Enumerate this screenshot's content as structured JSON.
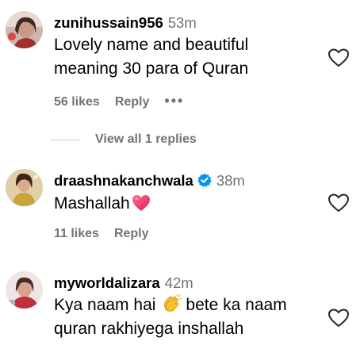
{
  "comments": [
    {
      "username": "zunihussain956",
      "time": "53m",
      "lines": [
        "Lovely name and beautiful",
        "meaning 30 para of Quran"
      ],
      "likes": "56 likes",
      "reply": "Reply",
      "more": "•••",
      "view_replies": "View all 1 replies"
    },
    {
      "username": "draashnakanchwala",
      "time": "38m",
      "verified": true,
      "text": "Mashallah",
      "emoji": "heart-emoji",
      "likes": "11 likes",
      "reply": "Reply"
    },
    {
      "username": "myworldalizara",
      "time": "42m",
      "line1_a": "Kya naam hai",
      "emoji": "clapping-hands-emoji",
      "line1_b": "bete ka naam",
      "line2": "quran rakhiyega inshallah"
    }
  ],
  "colors": {
    "secondary_text": "#737373",
    "verified_badge": "#0095f6",
    "heart_emoji": "#f0386b"
  }
}
